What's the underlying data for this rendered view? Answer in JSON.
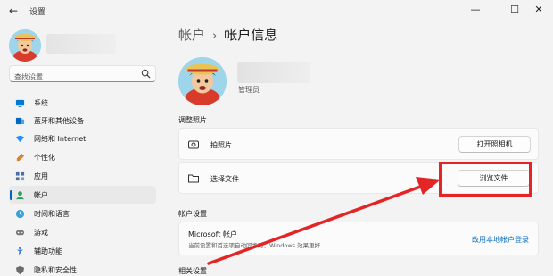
{
  "window": {
    "title": "设置",
    "back_glyph": "←",
    "minimize_glyph": "—",
    "maximize_glyph": "☐",
    "close_glyph": "✕"
  },
  "sidebar": {
    "search": {
      "placeholder": "查找设置"
    },
    "items": [
      {
        "label": "系统",
        "icon": "system-icon",
        "color": "#0078d4"
      },
      {
        "label": "蓝牙和其他设备",
        "icon": "bluetooth-icon",
        "color": "#0067c0"
      },
      {
        "label": "网络和 Internet",
        "icon": "network-icon",
        "color": "#1e90ff"
      },
      {
        "label": "个性化",
        "icon": "personalization-icon",
        "color": "#d9822b"
      },
      {
        "label": "应用",
        "icon": "apps-icon",
        "color": "#4a6fa5"
      },
      {
        "label": "帐户",
        "icon": "accounts-icon",
        "color": "#2e9e5b",
        "active": true
      },
      {
        "label": "时间和语言",
        "icon": "time-language-icon",
        "color": "#3aa0d8"
      },
      {
        "label": "游戏",
        "icon": "gaming-icon",
        "color": "#777777"
      },
      {
        "label": "辅助功能",
        "icon": "accessibility-icon",
        "color": "#3a7bd5"
      },
      {
        "label": "隐私和安全性",
        "icon": "privacy-icon",
        "color": "#6b6b6b"
      }
    ]
  },
  "main": {
    "breadcrumb": {
      "parent": "帐户",
      "separator": "›",
      "current": "帐户信息"
    },
    "profile": {
      "role": "管理员"
    },
    "adjust_photo": {
      "heading": "调整照片",
      "camera": {
        "label": "拍照片",
        "button": "打开照相机"
      },
      "file": {
        "label": "选择文件",
        "button": "浏览文件"
      }
    },
    "account_settings": {
      "heading": "帐户设置",
      "microsoft": {
        "title": "Microsoft 帐户",
        "description": "当前设置和首选项自动同步时，Windows 效果更好",
        "link": "改用本地帐户登录"
      }
    },
    "related_heading": "相关设置"
  },
  "annotation": {
    "color": "#e32525"
  }
}
